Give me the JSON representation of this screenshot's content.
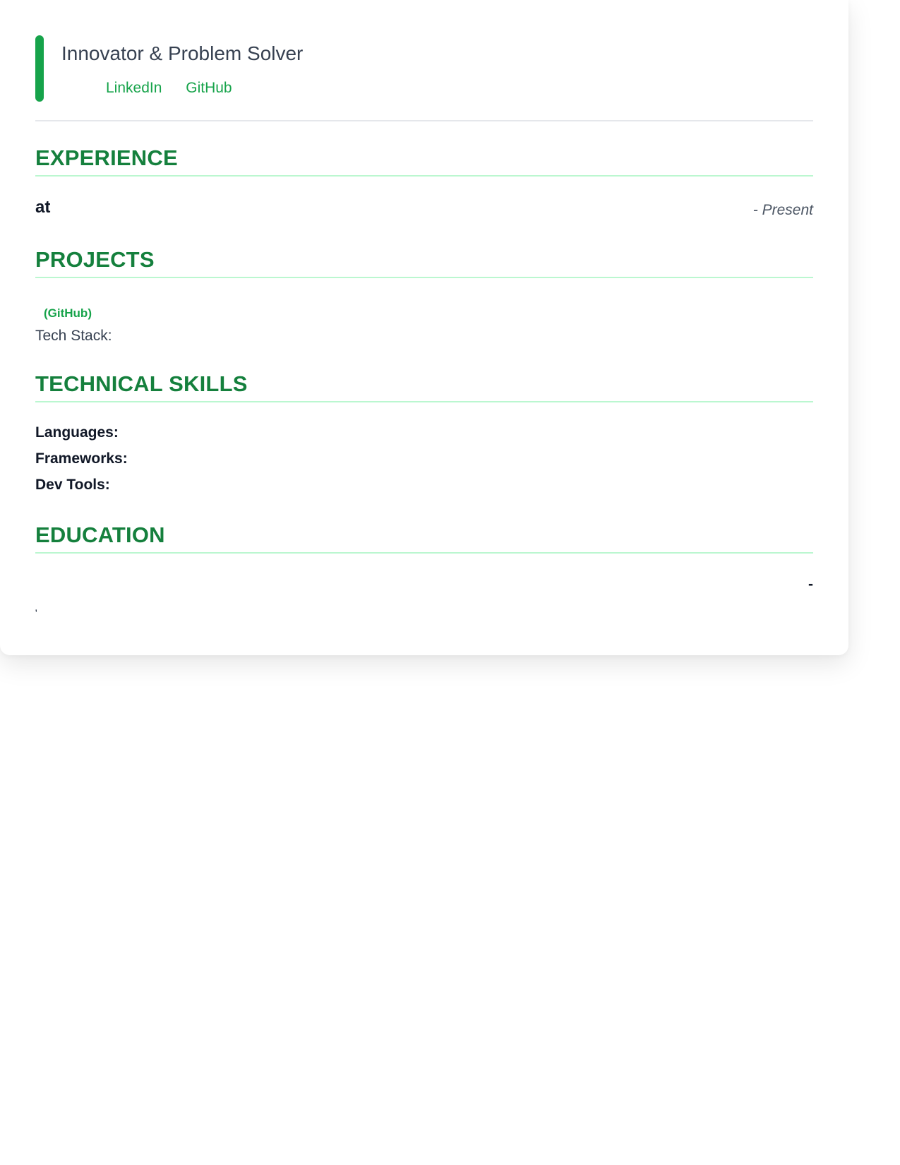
{
  "header": {
    "tagline": "Innovator & Problem Solver",
    "links": {
      "linkedin": "LinkedIn",
      "github": "GitHub"
    }
  },
  "sections": {
    "experience": "EXPERIENCE",
    "projects": "PROJECTS",
    "skills": "TECHNICAL SKILLS",
    "education": "EDUCATION"
  },
  "experience": {
    "title": "at",
    "dates": "- Present"
  },
  "projects": {
    "link": "(GitHub)",
    "tech_stack": "Tech Stack:"
  },
  "skills": {
    "languages": "Languages:",
    "frameworks": "Frameworks:",
    "dev_tools": "Dev Tools:"
  },
  "education": {
    "dates": "-",
    "location": ","
  },
  "colors": {
    "accent": "#16a34a",
    "heading": "#15803d",
    "divider": "#bbf7d0"
  }
}
